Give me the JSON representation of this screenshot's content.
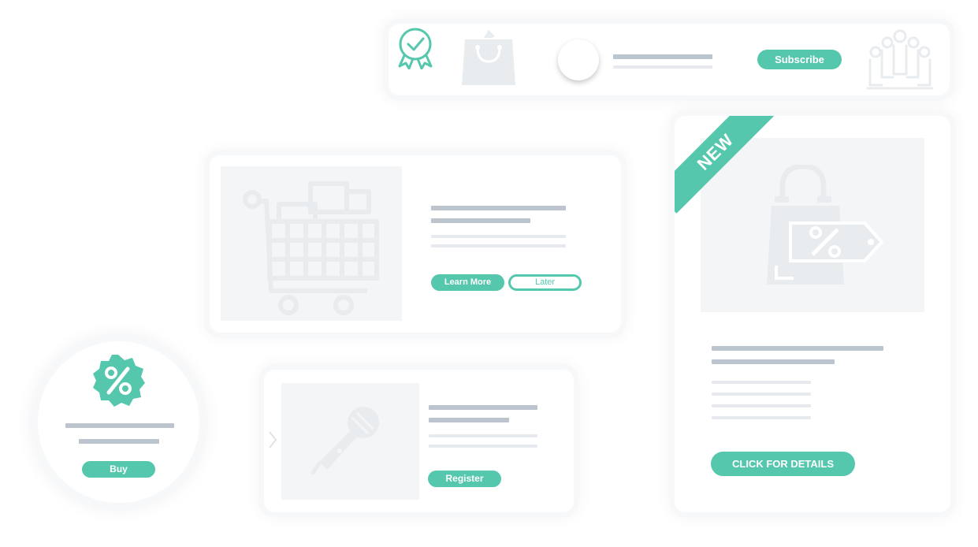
{
  "banner": {
    "subscribe_label": "Subscribe"
  },
  "product_card": {
    "learn_more_label": "Learn More",
    "later_label": "Later"
  },
  "promo_card": {
    "ribbon_label": "NEW",
    "details_label": "CLICK FOR DETAILS"
  },
  "discount_circle": {
    "buy_label": "Buy"
  },
  "event_card": {
    "register_label": "Register"
  },
  "colors": {
    "accent": "#55c7ad",
    "placeholder_dark": "#bcc4cd",
    "placeholder_light": "#e6e9ed",
    "image_bg": "#f4f5f7",
    "icon_fill": "#e9ecef"
  },
  "icons": [
    "award-icon",
    "shopping-bag-icon",
    "avatar",
    "crowd-icon",
    "shopping-cart-icon",
    "discount-bag-icon",
    "percent-badge-icon",
    "chevron-right-icon",
    "microphone-icon"
  ]
}
